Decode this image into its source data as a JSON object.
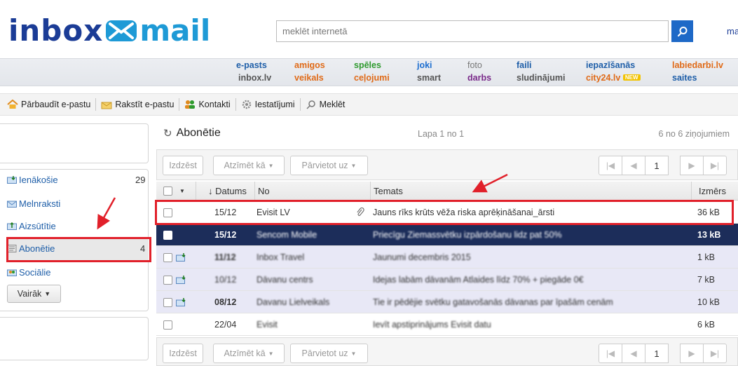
{
  "logo": {
    "inbox": "inbox",
    "mail": "mail"
  },
  "search": {
    "placeholder": "meklēt internetā"
  },
  "header_right": "ma",
  "nav": {
    "row1": [
      "e-pasts",
      "amigos",
      "spēles",
      "joki",
      "foto",
      "faili",
      "iepazīšanās",
      "labiedarbi.lv"
    ],
    "row2": [
      "inbox.lv",
      "veikals",
      "ceļojumi",
      "smart",
      "darbs",
      "sludinājumi",
      "city24.lv",
      "saites"
    ],
    "new_badge": "NEW"
  },
  "toolbar": {
    "check": "Pārbaudīt e-pastu",
    "write": "Rakstīt e-pastu",
    "contacts": "Kontakti",
    "settings": "Iestatījumi",
    "search": "Meklēt"
  },
  "folders": [
    {
      "label": "Ienākošie",
      "count": "29"
    },
    {
      "label": "Melnraksti",
      "count": ""
    },
    {
      "label": "Aizsūtītie",
      "count": ""
    },
    {
      "label": "Abonētie",
      "count": "4"
    },
    {
      "label": "Sociālie",
      "count": ""
    }
  ],
  "more_button": "Vairāk",
  "main": {
    "title": "Abonētie",
    "page_info": "Lapa 1 no 1",
    "msg_count": "6 no 6 ziņojumiem"
  },
  "actions": {
    "delete": "Izdzēst",
    "mark": "Atzīmēt kā",
    "move": "Pārvietot uz"
  },
  "pagination": {
    "current": "1"
  },
  "table": {
    "headers": {
      "date": "↓ Datums",
      "from": "No",
      "subject": "Temats",
      "size": "Izmērs"
    },
    "rows": [
      {
        "date": "15/12",
        "from": "Evisit LV",
        "subject": "Jauns rīks krūts vēža riska aprēķināšanai_ārsti",
        "size": "36 kB"
      },
      {
        "date": "15/12",
        "from": "Sencom Mobile",
        "subject": "Priecīgu Ziemassvētku izpārdošanu lidz pat 50%",
        "size": "13 kB"
      },
      {
        "date": "11/12",
        "from": "Inbox Travel",
        "subject": "Jaunumi decembris 2015",
        "size": "1 kB"
      },
      {
        "date": "10/12",
        "from": "Dāvanu centrs",
        "subject": "Idejas labām dāvanām Atlaides līdz 70% + piegāde 0€",
        "size": "7 kB"
      },
      {
        "date": "08/12",
        "from": "Davanu Lielveikals",
        "subject": "Tie ir pēdējie svētku gatavošanās dāvanas par īpašām cenām",
        "size": "10 kB"
      },
      {
        "date": "22/04",
        "from": "Evisit",
        "subject": "Ievīt apstiprinājums Evisit datu",
        "size": "6 kB"
      }
    ]
  },
  "colors": {
    "brand_dark": "#1b3c96",
    "brand_light": "#1e9ad6",
    "selected_row": "#1c2d5a",
    "annotation": "#e1202a"
  }
}
